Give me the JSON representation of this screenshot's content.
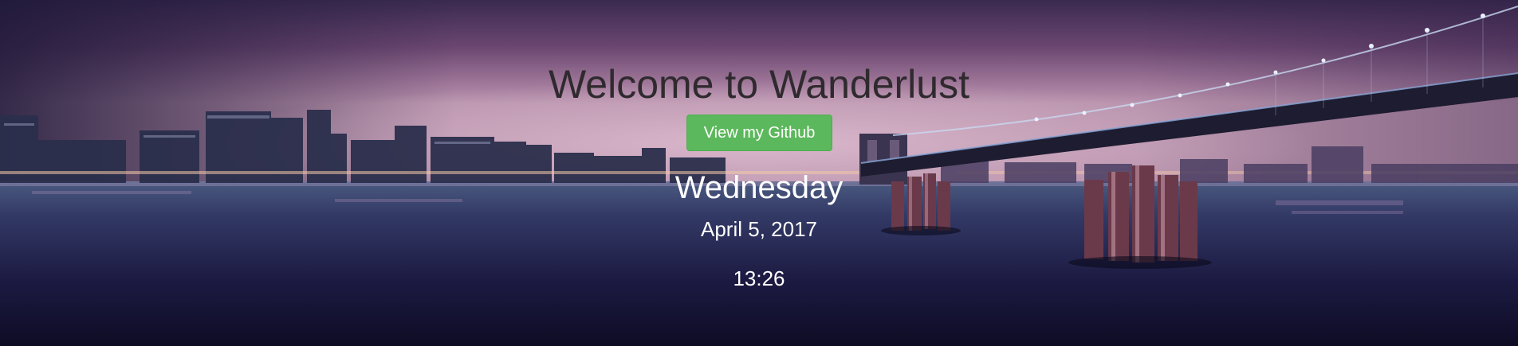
{
  "hero": {
    "title": "Welcome to Wanderlust",
    "github_button_label": "View my Github",
    "day": "Wednesday",
    "date": "April 5, 2017",
    "time": "13:26"
  },
  "colors": {
    "button_green": "#5cb85c",
    "title_text": "#2f2a2e",
    "sky_purple": "#8c5a88",
    "water_dark": "#141431"
  },
  "background": {
    "scene": "city skyline at night with bridge and pier pilings over water"
  }
}
